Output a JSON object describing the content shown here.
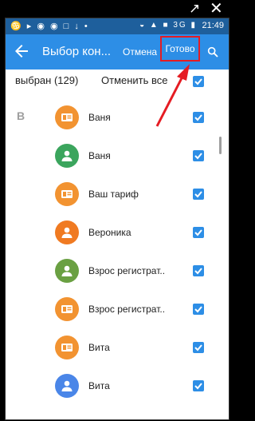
{
  "topbar": {
    "open_icon": "open-external-icon",
    "close_icon": "close-icon"
  },
  "status": {
    "left_icons": "♋ ▸ ◉ ◉ □ ↓ •",
    "right_icons": "◒ ▲ ■ 3G ▮",
    "time": "21:49"
  },
  "appbar": {
    "title": "Выбор кон...",
    "cancel_label": "Отмена",
    "done_label": "Готово",
    "back_icon": "arrow-back-icon",
    "search_icon": "search-icon"
  },
  "selection": {
    "count_label": "выбран (129)",
    "cancel_all_label": "Отменить все"
  },
  "section_letter": "В",
  "contacts": [
    {
      "name": "Ваня",
      "avatar_color": "#f29331",
      "avatar_icon": "contact-card-icon"
    },
    {
      "name": "Ваня",
      "avatar_color": "#3ba55d",
      "avatar_icon": "person-icon"
    },
    {
      "name": "Ваш тариф",
      "avatar_color": "#f29331",
      "avatar_icon": "contact-card-icon"
    },
    {
      "name": "Вероника",
      "avatar_color": "#f07a21",
      "avatar_icon": "person-icon"
    },
    {
      "name": "Взрос регистрат..",
      "avatar_color": "#6aa042",
      "avatar_icon": "person-icon"
    },
    {
      "name": "Взрос регистрат..",
      "avatar_color": "#f29331",
      "avatar_icon": "contact-card-icon"
    },
    {
      "name": "Вита",
      "avatar_color": "#f29331",
      "avatar_icon": "contact-card-icon"
    },
    {
      "name": "Вита",
      "avatar_color": "#4a86e8",
      "avatar_icon": "person-icon"
    }
  ],
  "colors": {
    "appbar": "#2d8ee6",
    "statusbar": "#1e5f9c",
    "checkbox": "#2d8ee6",
    "highlight": "#e51c23"
  }
}
